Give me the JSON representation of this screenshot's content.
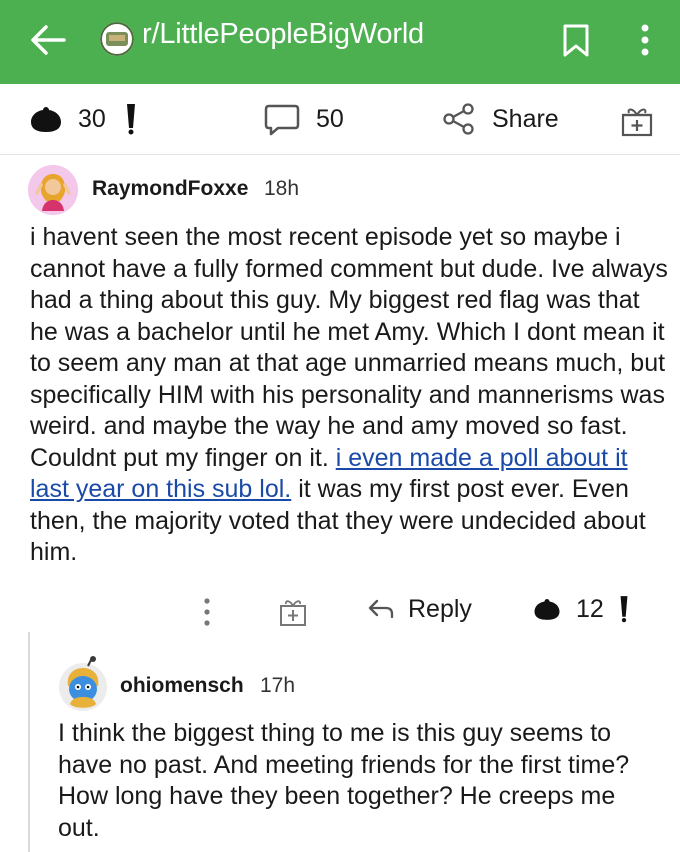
{
  "header": {
    "subreddit": "r/LittlePeopleBigWorld",
    "accent": "#4caf50"
  },
  "post_actions": {
    "upvotes": "30",
    "comments": "50",
    "share": "Share"
  },
  "comment1": {
    "username": "RaymondFoxxe",
    "time": "18h",
    "text_before": "i havent seen the most recent episode yet so maybe i cannot have a fully formed comment but dude.  Ive always had a thing about this guy.  My biggest red flag was that he was a bachelor until he met Amy. Which I dont mean it to seem any man at that age unmarried means much, but specifically HIM with his personality and mannerisms was weird.  and maybe the way he and amy moved so fast. Couldnt put my finger on it. ",
    "link_text": "i even made a poll about it last year on this sub lol.",
    "text_after": " it was my first post ever. Even then, the majority voted that they were undecided about him.",
    "reply_label": "Reply",
    "votes": "12"
  },
  "comment2": {
    "username": "ohiomensch",
    "time": "17h",
    "text": "I think the biggest thing to me is this guy seems to have no past.  And meeting friends for the first time?  How long have they been together?  He creeps me out."
  }
}
